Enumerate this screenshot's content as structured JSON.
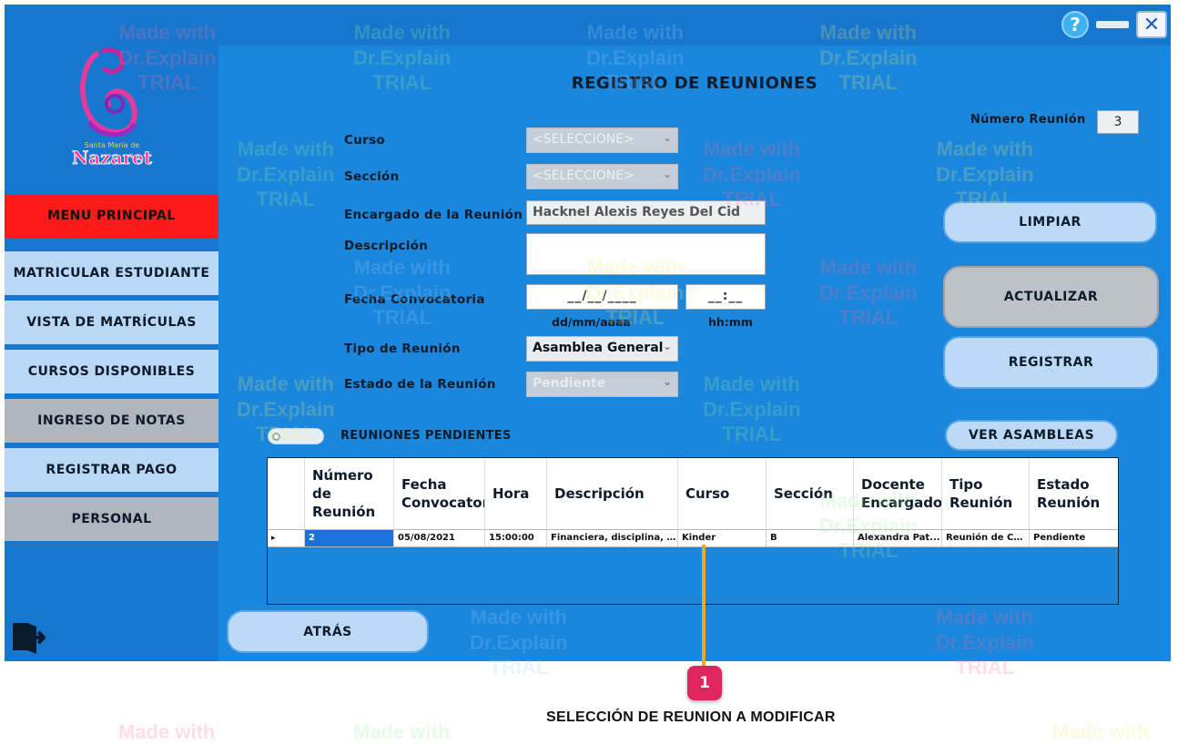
{
  "window": {
    "help_label": "?",
    "close_label": "✕"
  },
  "sidebar": {
    "menu_principal": "MENU PRINCIPAL",
    "items": [
      {
        "label": "MATRICULAR ESTUDIANTE"
      },
      {
        "label": "VISTA DE MATRÍCULAS"
      },
      {
        "label": "CURSOS DISPONIBLES"
      },
      {
        "label": "INGRESO DE NOTAS"
      },
      {
        "label": "REGISTRAR PAGO"
      },
      {
        "label": "PERSONAL"
      }
    ],
    "logo_text": "Nazaret",
    "logo_subtext": "Santa María de"
  },
  "form": {
    "title": "REGISTRO DE REUNIONES",
    "numero_label": "Número Reunión",
    "numero_value": "3",
    "curso_label": "Curso",
    "curso_value": "<SELECCIONE>",
    "seccion_label": "Sección",
    "seccion_value": "<SELECCIONE>",
    "encargado_label": "Encargado de la Reunión",
    "encargado_value": "Hacknel Alexis Reyes Del Cid",
    "descripcion_label": "Descripción",
    "descripcion_value": "",
    "fecha_label": "Fecha Convocatoria",
    "fecha_value": "__/__/____",
    "fecha_hint": "dd/mm/aaaa",
    "hora_value": "__:__",
    "hora_hint": "hh:mm",
    "tipo_label": "Tipo de Reunión",
    "tipo_value": "Asamblea General",
    "estado_label": "Estado de la Reunión",
    "estado_value": "Pendiente"
  },
  "buttons": {
    "limpiar": "LIMPIAR",
    "actualizar": "ACTUALIZAR",
    "registrar": "REGISTRAR",
    "ver_asambleas": "VER ASAMBLEAS",
    "atras": "ATRÁS"
  },
  "toggle": {
    "label": "REUNIONES PENDIENTES"
  },
  "grid": {
    "columns": [
      "Número\nde\nReunión",
      "Fecha\nConvocatoria",
      "Hora",
      "Descripción",
      "Curso",
      "Sección",
      "Docente\nEncargado",
      "Tipo\nReunión",
      "Estado\nReunión"
    ],
    "rows": [
      [
        "2",
        "05/08/2021",
        "15:00:00",
        "Financiera, disciplina, a...",
        "Kinder",
        "B",
        "Alexandra Pat...",
        "Reunión de Cu...",
        "Pendiente"
      ]
    ],
    "row_indicator": "▸"
  },
  "annotation": {
    "badge": "1",
    "caption": "SELECCIÓN DE REUNION A MODIFICAR"
  },
  "watermark": {
    "line1": "Made with",
    "line2": "Dr.Explain",
    "line3": "TRIAL"
  },
  "colors": {
    "window_bg": "#1777cf",
    "panel_bg": "#1a86dc",
    "menu_principal": "#ff1a1a",
    "badge": "#e0245e",
    "marker": "#f2a81d"
  }
}
